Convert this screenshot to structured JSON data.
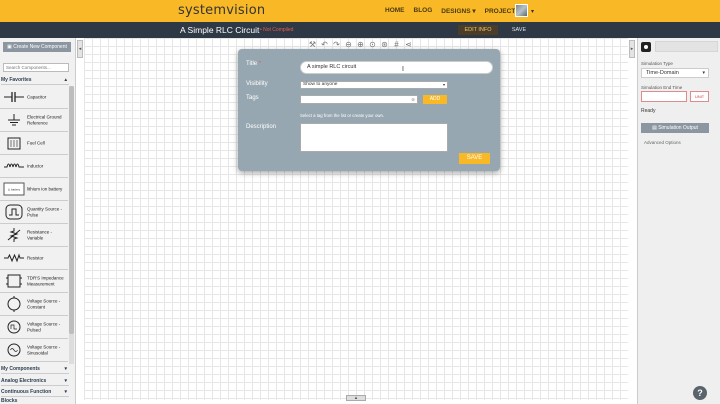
{
  "nav": {
    "logo": "systemvision",
    "links": [
      "HOME",
      "BLOG",
      "DESIGNS ▾",
      "PROJECTS ▾"
    ]
  },
  "titlebar": {
    "title": "A Simple RLC Circuit",
    "subtitle": "• Not Compiled",
    "edit_info": "EDIT INFO",
    "save": "SAVE"
  },
  "sidebar": {
    "create_button": "Create New Component",
    "search_placeholder": "Search Components...",
    "favorites_label": "My Favorites",
    "components": [
      {
        "label": "Capacitor",
        "icon": "capacitor-icon"
      },
      {
        "label": "Electrical Ground Reference",
        "icon": "ground-icon"
      },
      {
        "label": "Fuel Cell",
        "icon": "fuel-cell-icon"
      },
      {
        "label": "Inductor",
        "icon": "inductor-icon"
      },
      {
        "label": "lithium ion battery",
        "icon": "battery-icon"
      },
      {
        "label": "Quantity Source - Pulse",
        "icon": "pulse-source-icon"
      },
      {
        "label": "Resistance - Variable",
        "icon": "variable-resistor-icon"
      },
      {
        "label": "Resistor",
        "icon": "resistor-icon"
      },
      {
        "label": "TDR'S Impedance Measurement",
        "icon": "impedance-icon"
      },
      {
        "label": "Voltage Source - Constant",
        "icon": "voltage-constant-icon"
      },
      {
        "label": "Voltage Source - Pulsed",
        "icon": "voltage-pulsed-icon"
      },
      {
        "label": "Voltage Source - Sinusoidal",
        "icon": "voltage-sine-icon"
      }
    ],
    "sections": [
      "My Components",
      "Analog Electronics",
      "Continuous Function Blocks"
    ],
    "battery_icon_text": "Li battery"
  },
  "right_panel": {
    "sim_type_label": "Simulation Type",
    "sim_type_value": "Time-Domain",
    "end_time_label": "Simulation End Time",
    "end_time_units": "UNIT",
    "status": "Ready",
    "output_button": "Simulation Output",
    "advanced": "Advanced Options"
  },
  "modal": {
    "title_label": "Title",
    "title_required": "*",
    "title_value": "A simple RLC circuit",
    "visibility_label": "Visibility",
    "visibility_value": "Show to anyone",
    "tags_label": "Tags",
    "add_button": "ADD",
    "tags_hint": "Select a tag from the list or create your own.",
    "description_label": "Description",
    "save_button": "SAVE"
  },
  "colors": {
    "brand": "#f9b826",
    "titlebar": "#2f3945",
    "modal": "#97a7b1"
  }
}
